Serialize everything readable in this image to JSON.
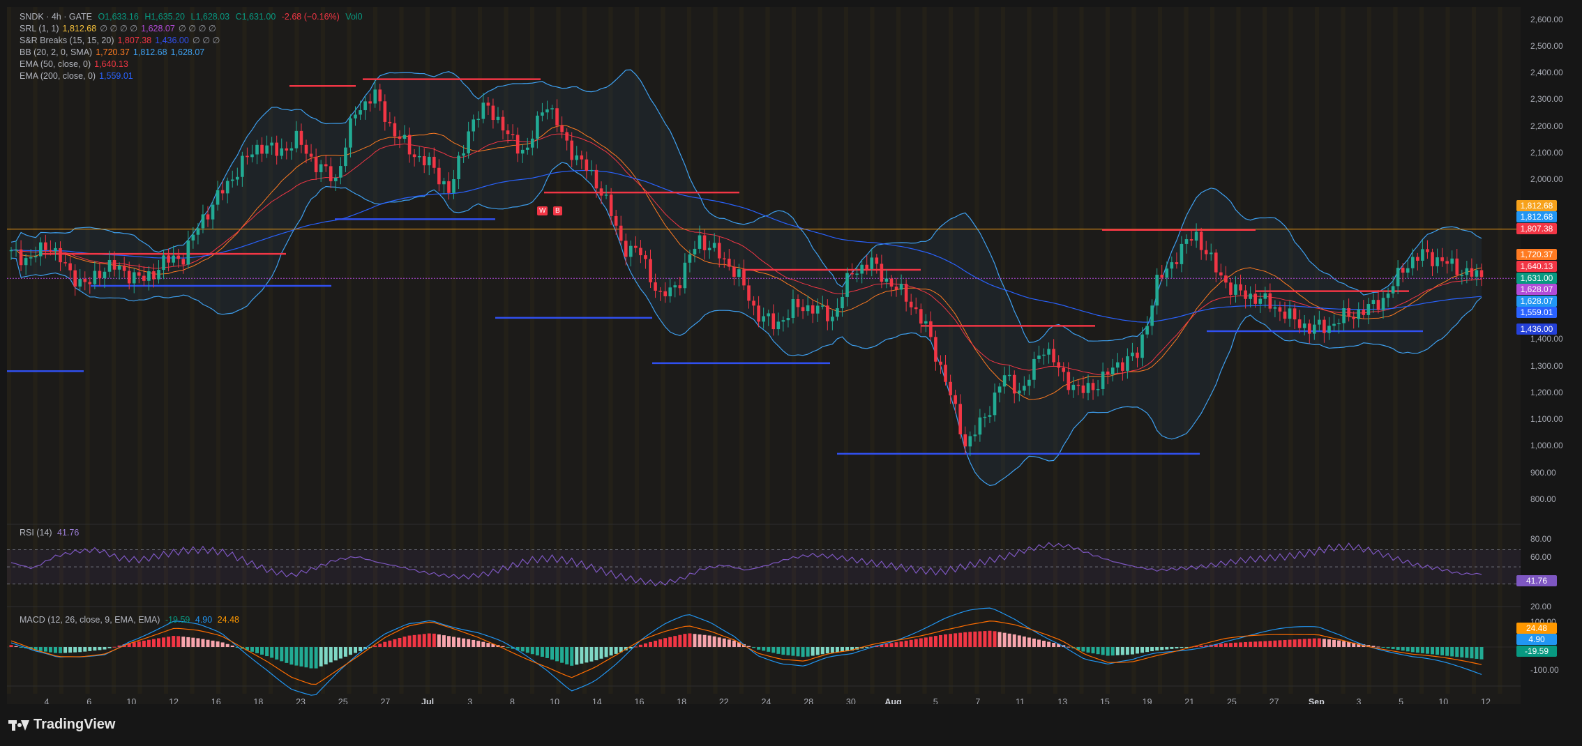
{
  "header": {
    "symbol": "SNDK · 4h · GATE",
    "ohlc": {
      "open": "O1,633.16",
      "high": "H1,635.20",
      "low": "L1,628.03",
      "close": "C1,631.00",
      "change": "-2.68 (−0.16%)",
      "volume": "Vol0"
    }
  },
  "indicators": [
    {
      "label": "SRL (1, 1)",
      "values": [
        "1,812.68",
        "∅ ∅ ∅ ∅",
        "1,628.07",
        "∅ ∅ ∅ ∅"
      ],
      "colors": [
        "#f7c23b",
        "#9598a1",
        "#b24bd8",
        "#9598a1"
      ]
    },
    {
      "label": "S&R Breaks (15, 15, 20)",
      "values": [
        "1,807.38",
        "1,436.00",
        "∅ ∅ ∅"
      ],
      "colors": [
        "#f23645",
        "#3050f0",
        "#9598a1"
      ]
    },
    {
      "label": "BB (20, 2, 0, SMA)",
      "values": [
        "1,720.37",
        "1,812.68",
        "1,628.07"
      ],
      "colors": [
        "#ff7b22",
        "#3ea0f0",
        "#3ea0f0"
      ]
    },
    {
      "label": "EMA (50, close, 0)",
      "values": [
        "1,640.13"
      ],
      "colors": [
        "#f23645"
      ]
    },
    {
      "label": "EMA (200, close, 0)",
      "values": [
        "1,559.01"
      ],
      "colors": [
        "#2962ff"
      ]
    }
  ],
  "rsi": {
    "label": "RSI (14)",
    "value": "41.76",
    "axis": [
      "80.00",
      "60.00",
      "20.00"
    ],
    "tag": "41.76"
  },
  "macd": {
    "label": "MACD (12, 26, close, 9, EMA, EMA)",
    "values": [
      "-19.59",
      "4.90",
      "24.48"
    ],
    "axis": [
      "100.00",
      "-100.00"
    ],
    "tags": [
      "24.48",
      "4.90",
      "-19.59"
    ]
  },
  "price_axis": [
    "2,600.00",
    "2,500.00",
    "2,400.00",
    "2,300.00",
    "2,200.00",
    "2,100.00",
    "2,000.00",
    "1,400.00",
    "1,300.00",
    "1,200.00",
    "1,100.00",
    "1,000.00",
    "900.00",
    "800.00"
  ],
  "price_tags": [
    {
      "value": "1,812.68",
      "color": "#f7a21b"
    },
    {
      "value": "1,812.68",
      "color": "#2196f3"
    },
    {
      "value": "1,807.38",
      "color": "#f23645"
    },
    {
      "value": "1,720.37",
      "color": "#ff7b22"
    },
    {
      "value": "1,640.13",
      "color": "#f23645"
    },
    {
      "value": "1,631.00",
      "color": "#089981"
    },
    {
      "value": "1,628.07",
      "color": "#b24bd8"
    },
    {
      "value": "1,628.07",
      "color": "#2196f3"
    },
    {
      "value": "1,559.01",
      "color": "#2962ff"
    },
    {
      "value": "1,436.00",
      "color": "#2440d8"
    }
  ],
  "signal_labels": [
    "W",
    "B"
  ],
  "time_axis": [
    "4",
    "6",
    "10",
    "12",
    "16",
    "18",
    "23",
    "25",
    "27",
    "Jul",
    "3",
    "8",
    "10",
    "14",
    "16",
    "18",
    "22",
    "24",
    "28",
    "30",
    "Aug",
    "5",
    "7",
    "11",
    "13",
    "15",
    "19",
    "21",
    "25",
    "27",
    "Sep",
    "3",
    "5",
    "10",
    "12"
  ],
  "bold_time_labels": [
    "Jul",
    "Aug",
    "Sep"
  ],
  "brand": "TradingView",
  "chart_data": {
    "type": "candlestick",
    "timeframe": "4h",
    "x": [
      "4",
      "6",
      "10",
      "12",
      "16",
      "18",
      "23",
      "25",
      "27",
      "Jul",
      "3",
      "8",
      "10",
      "14",
      "16",
      "18",
      "22",
      "24",
      "28",
      "30",
      "Aug",
      "5",
      "7",
      "11",
      "13",
      "15",
      "19",
      "21",
      "25",
      "27",
      "Sep",
      "3",
      "5",
      "10",
      "12"
    ],
    "ylim": [
      750,
      2620
    ],
    "close_path": [
      1720,
      1700,
      1760,
      1650,
      1600,
      1680,
      1650,
      1620,
      1690,
      1710,
      1850,
      1950,
      2050,
      2130,
      2100,
      2150,
      2050,
      2000,
      2250,
      2320,
      2180,
      2100,
      2050,
      1950,
      2200,
      2280,
      2160,
      2100,
      2300,
      2140,
      2050,
      1950,
      1750,
      1720,
      1550,
      1620,
      1780,
      1720,
      1650,
      1500,
      1450,
      1520,
      1520,
      1480,
      1650,
      1690,
      1610,
      1550,
      1430,
      1230,
      1000,
      1110,
      1260,
      1200,
      1380,
      1270,
      1200,
      1240,
      1310,
      1340,
      1610,
      1710,
      1800,
      1670,
      1580,
      1560,
      1530,
      1480,
      1440,
      1450,
      1490,
      1510,
      1560,
      1680,
      1720,
      1690,
      1655,
      1631
    ],
    "series": [
      {
        "name": "BB (20, 2, 0, SMA)",
        "values": [
          1720.37,
          1812.68,
          1628.07
        ]
      },
      {
        "name": "EMA (50, close, 0)",
        "values": [
          1640.13
        ]
      },
      {
        "name": "EMA (200, close, 0)",
        "values": [
          1559.01
        ]
      }
    ],
    "resistance_levels": [
      1720,
      2350,
      2375,
      1810,
      1950,
      1660,
      1450,
      1800,
      1580
    ],
    "support_levels": [
      1600,
      1850,
      1280,
      1480,
      1310,
      970,
      1420,
      1430
    ],
    "rsi_path": [
      55,
      48,
      62,
      68,
      70,
      60,
      58,
      64,
      69,
      70,
      66,
      55,
      45,
      40,
      48,
      58,
      62,
      55,
      50,
      44,
      40,
      38,
      42,
      50,
      58,
      60,
      56,
      48,
      40,
      34,
      30,
      36,
      48,
      52,
      46,
      52,
      60,
      64,
      62,
      58,
      54,
      50,
      46,
      44,
      50,
      56,
      62,
      70,
      76,
      74,
      64,
      56,
      50,
      46,
      48,
      50,
      54,
      58,
      60,
      62,
      66,
      72,
      74,
      68,
      60,
      52,
      48,
      42,
      41.76
    ],
    "macd_hist": [
      3,
      -5,
      -10,
      -8,
      -4,
      6,
      12,
      18,
      14,
      8,
      -4,
      -15,
      -28,
      -35,
      -20,
      -6,
      8,
      18,
      22,
      16,
      10,
      2,
      -8,
      -18,
      -30,
      -22,
      -10,
      4,
      14,
      22,
      18,
      10,
      -4,
      -12,
      -16,
      -10,
      -6,
      2,
      8,
      14,
      20,
      24,
      26,
      20,
      12,
      4,
      -8,
      -14,
      -12,
      -6,
      -2,
      2,
      6,
      8,
      10,
      12,
      14,
      10,
      4,
      -2,
      -8,
      -12,
      -16,
      -19.59
    ],
    "macd_line": 4.9,
    "macd_signal": 24.48,
    "rsi_value": 41.76
  }
}
